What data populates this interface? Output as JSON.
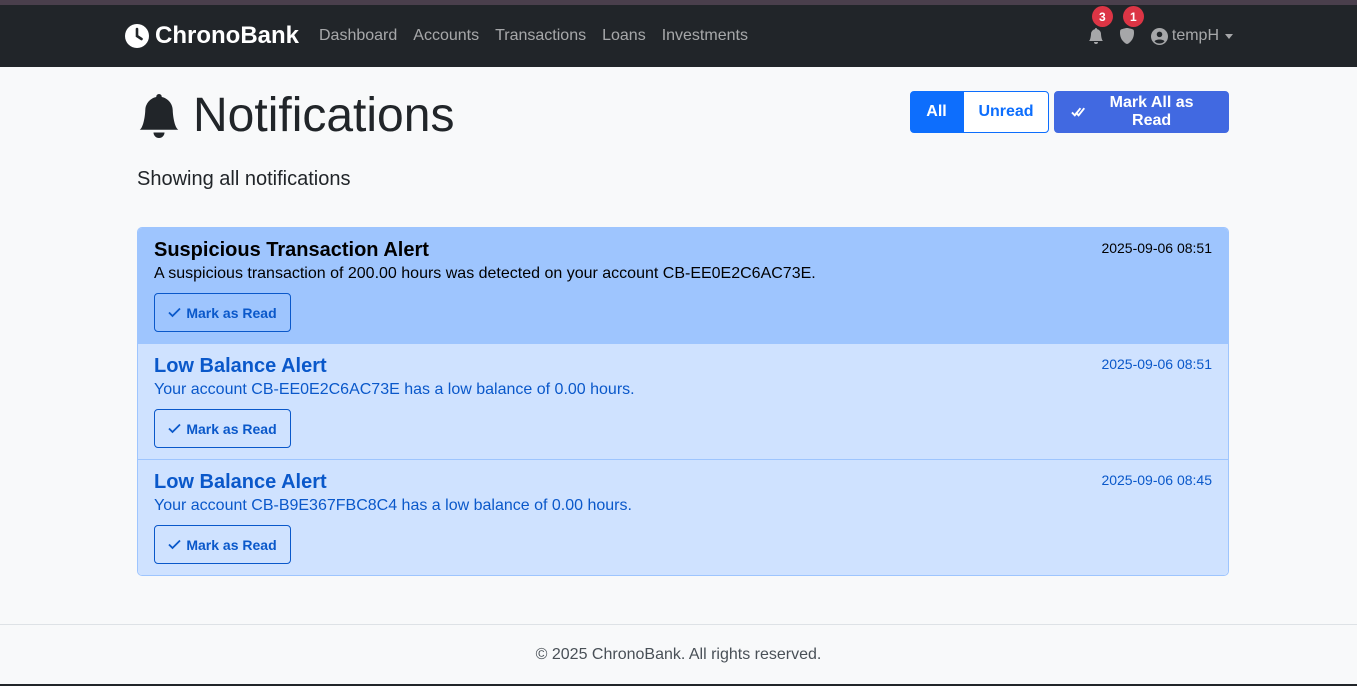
{
  "nav": {
    "brand": "ChronoBank",
    "links": [
      "Dashboard",
      "Accounts",
      "Transactions",
      "Loans",
      "Investments"
    ],
    "notifications_badge": "3",
    "security_badge": "1",
    "username": "tempH"
  },
  "header": {
    "title": "Notifications",
    "subtitle": "Showing all notifications"
  },
  "filters": {
    "all_label": "All",
    "unread_label": "Unread",
    "mark_all_label": "Mark All as Read"
  },
  "notifications": [
    {
      "title": "Suspicious Transaction Alert",
      "message": "A suspicious transaction of 200.00 hours was detected on your account CB-EE0E2C6AC73E.",
      "time": "2025-09-06 08:51",
      "action": "Mark as Read"
    },
    {
      "title": "Low Balance Alert",
      "message": "Your account CB-EE0E2C6AC73E has a low balance of 0.00 hours.",
      "time": "2025-09-06 08:51",
      "action": "Mark as Read"
    },
    {
      "title": "Low Balance Alert",
      "message": "Your account CB-B9E367FBC8C4 has a low balance of 0.00 hours.",
      "time": "2025-09-06 08:45",
      "action": "Mark as Read"
    }
  ],
  "footer": {
    "text": "© 2025 ChronoBank. All rights reserved."
  },
  "colors": {
    "navbar": "#212529",
    "primary": "#0d6efd",
    "mark_all": "#4169e1",
    "badge": "#dc3545",
    "alert_highlight": "#9ec5fe",
    "alert_light": "#cfe2ff"
  },
  "icons": {
    "brand": "clock-icon",
    "bell": "bell-icon",
    "shield": "shield-icon",
    "user": "user-circle-icon",
    "check": "check-icon",
    "check_double": "check-double-icon"
  }
}
